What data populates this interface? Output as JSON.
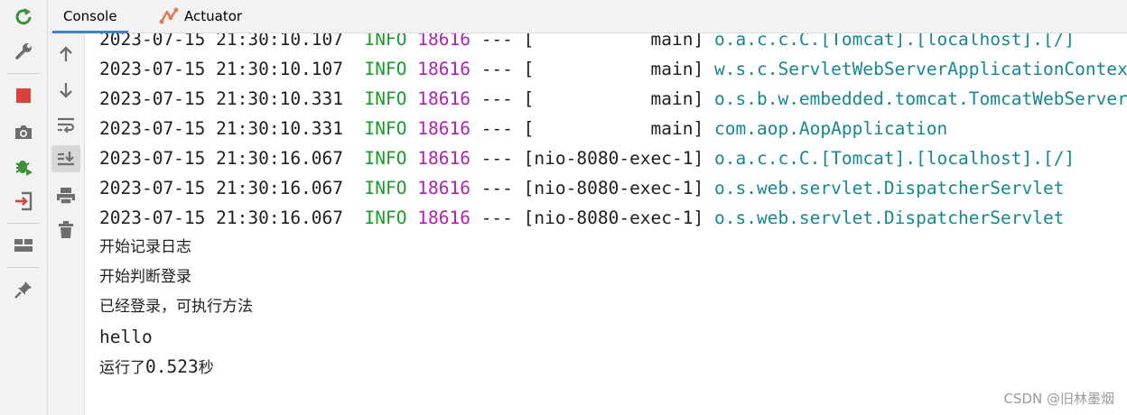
{
  "tabs": {
    "console": "Console",
    "actuator": "Actuator"
  },
  "left_toolbar": [
    "rerun-icon",
    "wrench-icon",
    "stop-icon",
    "camera-icon",
    "debug-icon",
    "login-icon",
    "layout-icon",
    "pin-icon"
  ],
  "console_toolbar": [
    "arrow-up-icon",
    "arrow-down-icon",
    "soft-wrap-icon",
    "scroll-to-end-icon",
    "print-icon",
    "trash-icon"
  ],
  "log_lines": [
    {
      "ts": "2023-07-15 21:30:10.107",
      "level": "INFO",
      "pid": "18616",
      "sep": "---",
      "thread": "[           main]",
      "logger": "o.a.c.c.C.[Tomcat].[localhost].[/]"
    },
    {
      "ts": "2023-07-15 21:30:10.107",
      "level": "INFO",
      "pid": "18616",
      "sep": "---",
      "thread": "[           main]",
      "logger": "w.s.c.ServletWebServerApplicationContext"
    },
    {
      "ts": "2023-07-15 21:30:10.331",
      "level": "INFO",
      "pid": "18616",
      "sep": "---",
      "thread": "[           main]",
      "logger": "o.s.b.w.embedded.tomcat.TomcatWebServer"
    },
    {
      "ts": "2023-07-15 21:30:10.331",
      "level": "INFO",
      "pid": "18616",
      "sep": "---",
      "thread": "[           main]",
      "logger": "com.aop.AopApplication"
    },
    {
      "ts": "2023-07-15 21:30:16.067",
      "level": "INFO",
      "pid": "18616",
      "sep": "---",
      "thread": "[nio-8080-exec-1]",
      "logger": "o.a.c.c.C.[Tomcat].[localhost].[/]"
    },
    {
      "ts": "2023-07-15 21:30:16.067",
      "level": "INFO",
      "pid": "18616",
      "sep": "---",
      "thread": "[nio-8080-exec-1]",
      "logger": "o.s.web.servlet.DispatcherServlet"
    },
    {
      "ts": "2023-07-15 21:30:16.067",
      "level": "INFO",
      "pid": "18616",
      "sep": "---",
      "thread": "[nio-8080-exec-1]",
      "logger": "o.s.web.servlet.DispatcherServlet"
    }
  ],
  "output_lines": {
    "line1": "开始记录日志",
    "line2": "开始判断登录",
    "line3": "已经登录，可执行方法",
    "line4": "hello",
    "line5_prefix": "运行了",
    "line5_value": "0.523",
    "line5_suffix": "秒"
  },
  "watermark": "CSDN @旧林墨烟",
  "colors": {
    "level": "#1a9a2a",
    "pid": "#b021b0",
    "logger": "#15878f",
    "tab_underline": "#4083c9"
  }
}
